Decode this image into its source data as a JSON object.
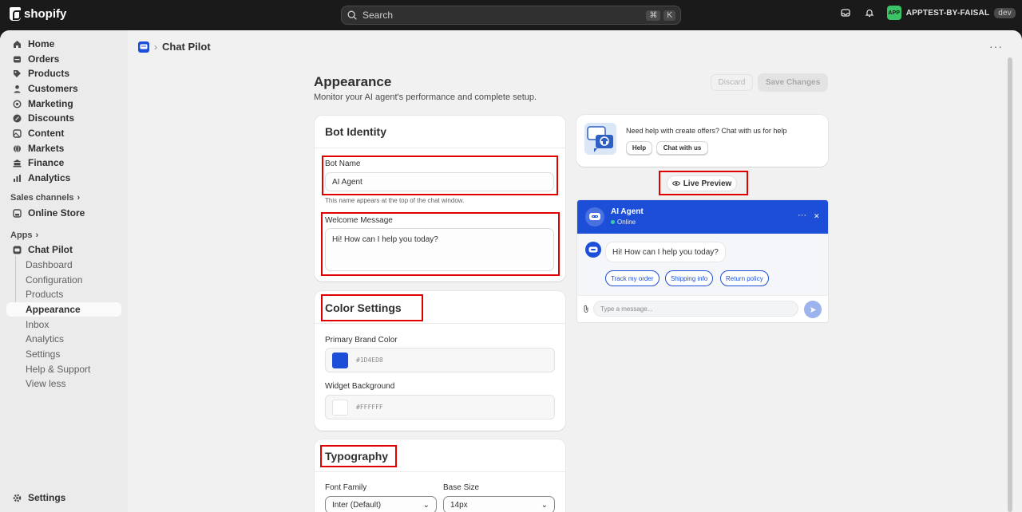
{
  "topbar": {
    "brand": "shopify",
    "search_placeholder": "Search",
    "shortcut_keys": [
      "⌘",
      "K"
    ],
    "store_avatar_text": "APP",
    "store_name": "APPTEST-BY-FAISAL",
    "store_badge": "dev"
  },
  "sidebar": {
    "items": [
      {
        "label": "Home",
        "icon": "home-icon"
      },
      {
        "label": "Orders",
        "icon": "orders-icon"
      },
      {
        "label": "Products",
        "icon": "tag-icon"
      },
      {
        "label": "Customers",
        "icon": "person-icon"
      },
      {
        "label": "Marketing",
        "icon": "target-icon"
      },
      {
        "label": "Discounts",
        "icon": "discount-icon"
      },
      {
        "label": "Content",
        "icon": "content-icon"
      },
      {
        "label": "Markets",
        "icon": "globe-icon"
      },
      {
        "label": "Finance",
        "icon": "bank-icon"
      },
      {
        "label": "Analytics",
        "icon": "chart-icon"
      }
    ],
    "sales_channels_label": "Sales channels",
    "online_store_label": "Online Store",
    "apps_label": "Apps",
    "app_name": "Chat Pilot",
    "app_sub_items": [
      "Dashboard",
      "Configuration",
      "Products",
      "Appearance",
      "Inbox",
      "Analytics",
      "Settings",
      "Help & Support",
      "View less"
    ],
    "active_sub_item": "Appearance",
    "settings_label": "Settings"
  },
  "breadcrumb": {
    "separator": "›",
    "title": "Chat Pilot"
  },
  "page": {
    "title": "Appearance",
    "subtitle": "Monitor your AI agent's performance and complete setup.",
    "discard_label": "Discard",
    "save_label": "Save Changes"
  },
  "bot_identity": {
    "heading": "Bot Identity",
    "bot_name_label": "Bot Name",
    "bot_name_value": "AI Agent",
    "bot_name_help": "This name appears at the top of the chat window.",
    "welcome_label": "Welcome Message",
    "welcome_value": "Hi! How can I help you today?"
  },
  "color_settings": {
    "heading": "Color Settings",
    "primary_label": "Primary Brand Color",
    "primary_value": "#1D4ED8",
    "primary_swatch": "#1d4ed8",
    "background_label": "Widget Background",
    "background_value": "#FFFFFF",
    "background_swatch": "#ffffff"
  },
  "typography": {
    "heading": "Typography",
    "font_family_label": "Font Family",
    "font_family_value": "Inter (Default)",
    "base_size_label": "Base Size",
    "base_size_value": "14px"
  },
  "help_card": {
    "text": "Need help with create offers? Chat with us for help",
    "help_button": "Help",
    "chat_button": "Chat with us"
  },
  "preview": {
    "live_preview_label": "Live Preview",
    "agent_name": "AI Agent",
    "status": "Online",
    "greeting": "Hi! How can I help you today?",
    "quick_replies": [
      "Track my order",
      "Shipping info",
      "Return policy"
    ],
    "input_placeholder": "Type a message...",
    "accent_color": "#1d4ed8"
  }
}
